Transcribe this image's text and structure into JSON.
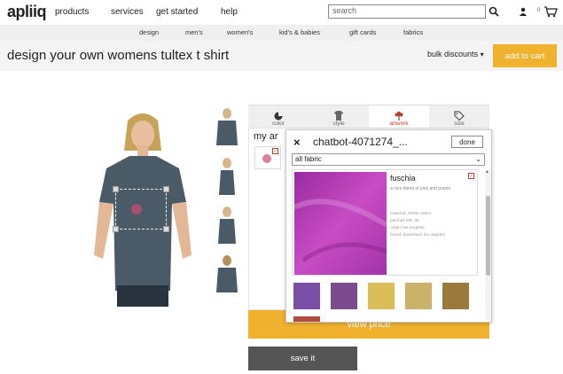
{
  "header": {
    "logo": "apliiq",
    "nav": [
      "products",
      "services",
      "get started",
      "help"
    ],
    "search_placeholder": "search",
    "cart_count": "0"
  },
  "subnav": [
    "design",
    "men's",
    "women's",
    "kid's & babies",
    "gift cards",
    "fabrics"
  ],
  "title_bar": {
    "title": "design your own womens tultex t shirt",
    "bulk": "bulk discounts",
    "add_to_cart": "add to cart"
  },
  "tabs": [
    {
      "label": "color",
      "icon": "color-wheel-icon"
    },
    {
      "label": "style",
      "icon": "tshirt-icon"
    },
    {
      "label": "artwork",
      "icon": "flower-icon",
      "active": true
    },
    {
      "label": "size",
      "icon": "tag-icon"
    }
  ],
  "panel": {
    "heading": "my ar"
  },
  "popup": {
    "close": "×",
    "title": "chatbot-4071274_...",
    "done": "done",
    "filter": "all fabric",
    "fabric": {
      "name": "fuschia",
      "description": "a nice blend of pink and purple",
      "material": "material: 100% cotton",
      "patches": "patches left: 35",
      "origin": "origin: los angeles",
      "found": "found: downtown los angeles"
    },
    "swatches": [
      "#7b4fa8",
      "#7c4a8f",
      "#d9bd55",
      "#cbb26a",
      "#9a7a3c"
    ]
  },
  "actions": {
    "view_price": "view price",
    "save": "save it"
  },
  "colors": {
    "accent": "#f0b12e",
    "fabric": "#b02fb0",
    "shirt": "#4a5a66"
  }
}
